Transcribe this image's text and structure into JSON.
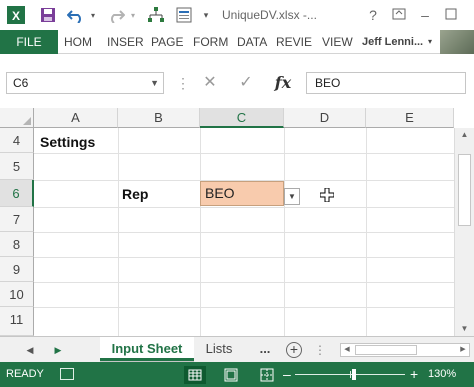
{
  "window": {
    "title": "UniqueDV.xlsx -..."
  },
  "ribbon": {
    "file_tab": "FILE",
    "tabs": [
      "HOM",
      "INSER",
      "PAGE",
      "FORM",
      "DATA",
      "REVIE",
      "VIEW"
    ],
    "user": "Jeff Lenni..."
  },
  "formula_bar": {
    "name_box": "C6",
    "formula": "BEO"
  },
  "grid": {
    "columns": [
      "A",
      "B",
      "C",
      "D",
      "E"
    ],
    "rows": [
      "4",
      "5",
      "6",
      "7",
      "8",
      "9",
      "10",
      "11"
    ],
    "cells": {
      "a4": "Settings",
      "b6": "Rep",
      "c6": "BEO"
    }
  },
  "sheets": {
    "tabs": [
      "Input Sheet",
      "Lists"
    ],
    "active": "Input Sheet",
    "more": "..."
  },
  "status": {
    "ready": "READY",
    "zoom": "130%"
  },
  "colors": {
    "excel_green": "#217346",
    "selected_cell_fill": "#f8cbad"
  }
}
